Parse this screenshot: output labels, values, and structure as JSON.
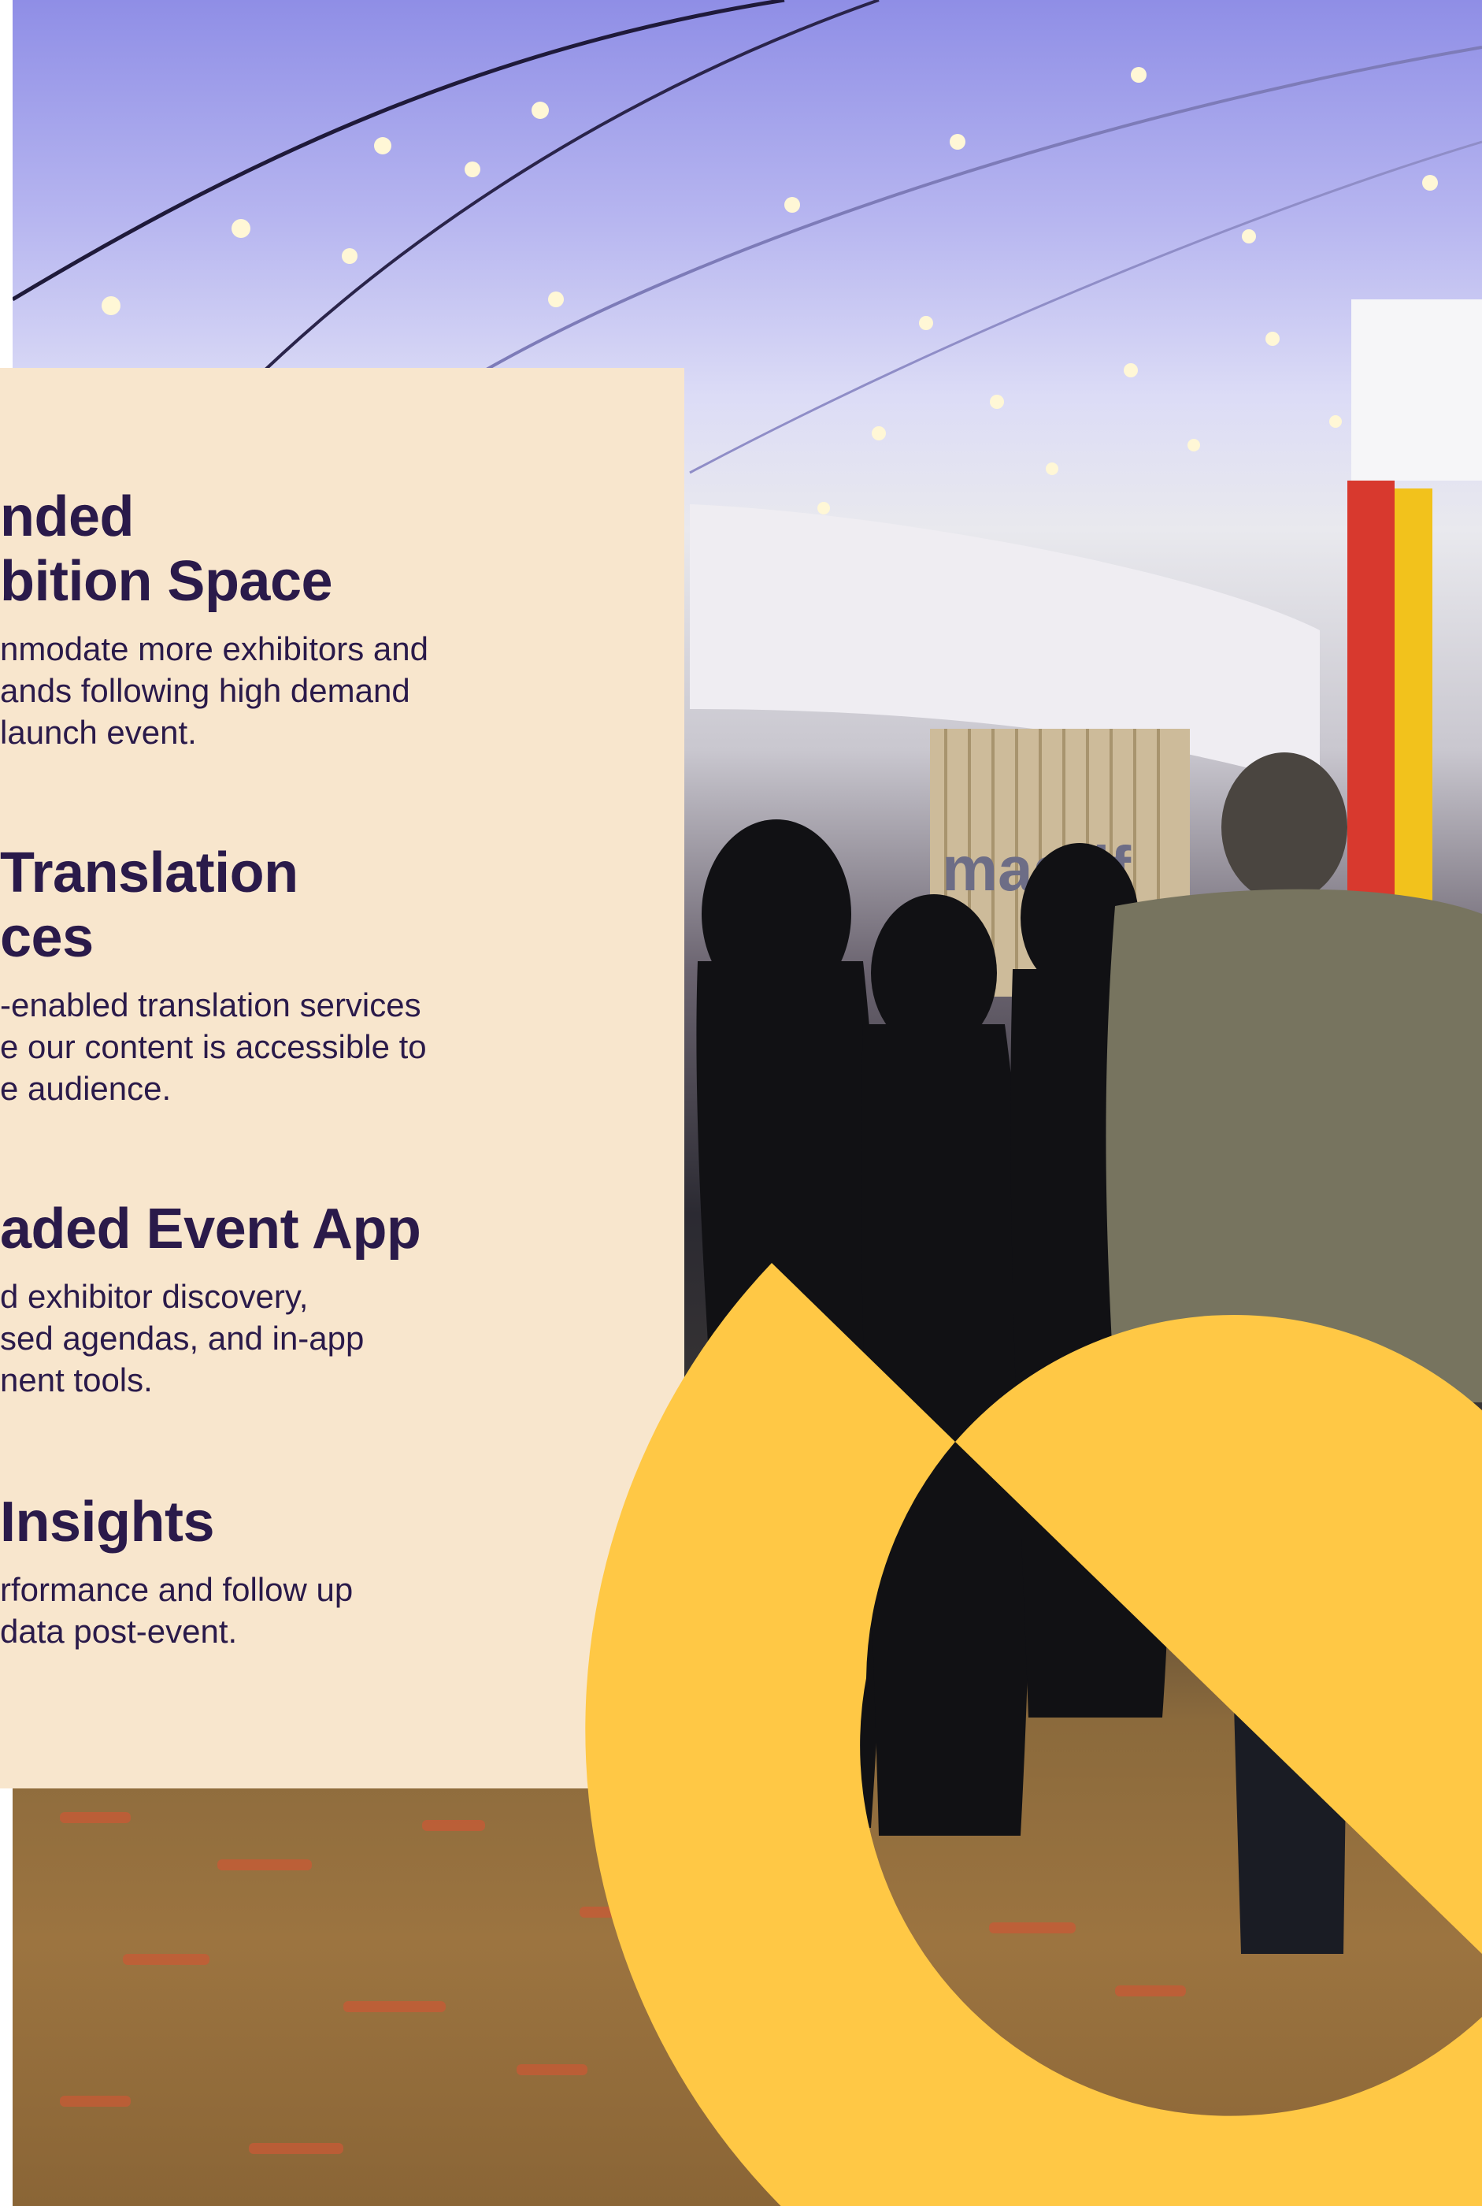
{
  "colors": {
    "panel_bg": "#f8e6cd",
    "heading": "#2a1a4a",
    "accent_yellow": "#ffc845"
  },
  "features": [
    {
      "title": "nded\nbition Space",
      "body": "nmodate more exhibitors and\nands following high demand\nlaunch event."
    },
    {
      "title": "Translation\nces",
      "body": "-enabled translation services\ne our content is accessible to\ne audience."
    },
    {
      "title": "aded Event App",
      "body": "d exhibitor discovery,\nsed agendas, and in-app\nnent tools."
    },
    {
      "title": " Insights",
      "body": "rformance and follow up\ndata post-event."
    }
  ],
  "photo": {
    "sign_text": "maarif"
  }
}
